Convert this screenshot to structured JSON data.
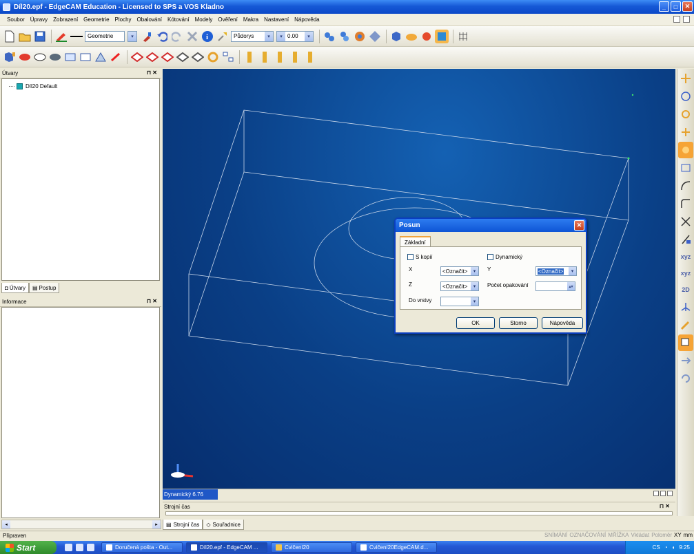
{
  "window": {
    "title": "Díl20.epf - EdgeCAM Education - Licensed to SPS a VOS Kladno"
  },
  "menu": [
    "Soubor",
    "Úpravy",
    "Zobrazení",
    "Geometrie",
    "Plochy",
    "Obalování",
    "Kótování",
    "Modely",
    "Ověření",
    "Makra",
    "Nastavení",
    "Nápověda"
  ],
  "toolbar": {
    "layer_combo": "Geometrie",
    "view_combo": "Půdorys",
    "depth_value": "0.00"
  },
  "panels": {
    "tree_title": "Útvary",
    "tree_item": "Díl20 Default",
    "tab_utvary": "Útvary",
    "tab_postup": "Postup",
    "info_title": "Informace",
    "pin_close": "⊓ ✕"
  },
  "viewport": {
    "dynamic_label": "Dynamický 6.76"
  },
  "machine_time": {
    "title": "Strojní čas",
    "tab_strojni": "Strojní čas",
    "tab_souradnice": "Souřadnice"
  },
  "status": {
    "left": "Připraven",
    "indicators": [
      "SNÍMÁNÍ",
      "OZNAČOVÁNÍ",
      "MŘÍŽKA",
      "Vkládat",
      "Poloměr",
      "XY",
      "mm"
    ]
  },
  "dialog": {
    "title": "Posun",
    "tab": "Základní",
    "s_kopii": "S kopií",
    "dynamicky": "Dynamický",
    "x_label": "X",
    "y_label": "Y",
    "z_label": "Z",
    "pocet_label": "Počet opakování",
    "do_vrstvy_label": "Do vrstvy",
    "x_value": "<Označit>",
    "y_value": "<Označit>",
    "z_value": "<Označit>",
    "ok": "OK",
    "storno": "Storno",
    "napoveda": "Nápověda"
  },
  "taskbar": {
    "start": "Start",
    "tasks": [
      "Doručená pošta - Out...",
      "Díl20.epf - EdgeCAM ...",
      "Cvičení20",
      "Cvičení20EdgeCAM.d..."
    ],
    "lang": "CS",
    "clock": "9:25"
  },
  "icons": [
    "new-file-icon",
    "open-folder-icon",
    "save-icon",
    "pen-color-icon",
    "undo-icon",
    "redo-icon",
    "delete-icon",
    "info-icon",
    "zoom-icon",
    "gear-icon",
    "grid-icon"
  ]
}
